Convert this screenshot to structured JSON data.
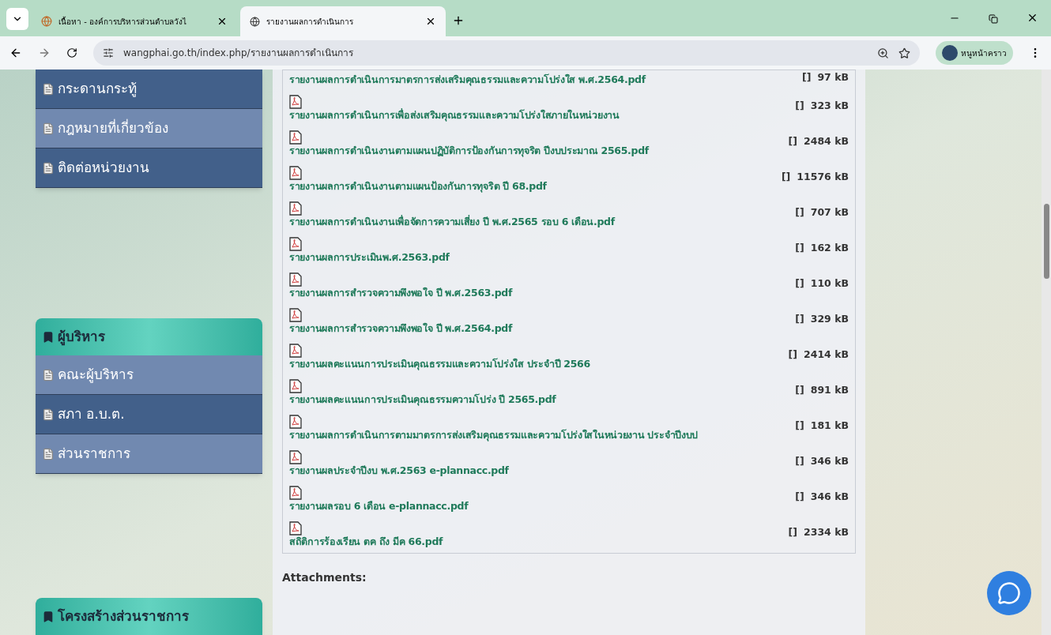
{
  "browser": {
    "tabs": [
      {
        "title": "เนื้อหา - องค์การบริหารส่วนตำบลวังไ",
        "selected": false
      },
      {
        "title": "รายงานผลการดำเนินการ",
        "selected": true
      }
    ],
    "url": "wangphai.go.th/index.php/รายงานผลการดำเนินการ",
    "profile": "หนูหน้าคราว"
  },
  "sidebar": {
    "groups": [
      {
        "items": [
          "กระดานกระทู้",
          "กฎหมายที่เกี่ยวข้อง",
          "ติดต่อหน่วยงาน"
        ]
      },
      {
        "title": "ผู้บริหาร",
        "items": [
          "คณะผู้บริหาร",
          "สภา อ.บ.ต.",
          "ส่วนราชการ"
        ]
      },
      {
        "title": "โครงสร้างส่วนราชการ"
      }
    ]
  },
  "files": [
    {
      "kind": "continued",
      "name": "รายงานผลการดำเนินการมาตรการส่งเสริมคุณธรรมและความโปร่งใส พ.ศ.2564.pdf",
      "marker": "[]",
      "size": "97 kB"
    },
    {
      "name": "รายงานผลการดำเนินการเพื่อส่งเสริมคุณธรรมและความโปร่งใสภายในหน่วยงาน",
      "marker": "[]",
      "size": "323 kB"
    },
    {
      "name": "รายงานผลการดำเนินงานตามแผนปฏิบัติการป้องกันการทุจริต ปีงบประมาณ 2565.pdf",
      "marker": "[]",
      "size": "2484 kB"
    },
    {
      "name": "รายงานผลการดำเนินงานตามแผนป้องกันการทุจริต ปี 68.pdf",
      "marker": "[]",
      "size": "11576 kB"
    },
    {
      "name": "รายงานผลการดำเนินงานเพื่อจัดการความเสี่ยง ปี พ.ศ.2565 รอบ 6 เดือน.pdf",
      "marker": "[]",
      "size": "707 kB"
    },
    {
      "name": "รายงานผลการประเมินพ.ศ.2563.pdf",
      "marker": "[]",
      "size": "162 kB"
    },
    {
      "name": "รายงานผลการสำรวจความพึงพอใจ ปี พ.ศ.2563.pdf",
      "marker": "[]",
      "size": "110 kB"
    },
    {
      "name": "รายงานผลการสำรวจความพึงพอใจ ปี พ.ศ.2564.pdf",
      "marker": "[]",
      "size": "329 kB"
    },
    {
      "name": "รายงานผลคะแนนการประเมินคุณธรรมและความโปร่งใส ประจำปี 2566",
      "marker": "[]",
      "size": "2414 kB"
    },
    {
      "name": "รายงานผลคะแนนการประเมินคุณธรรมความโปร่ง ปี 2565.pdf",
      "marker": "[]",
      "size": "891 kB"
    },
    {
      "name": "รายงานผลการดำเนินการตามมาตรการส่งเสริมคุณธรรมและความโปร่งใสในหน่วยงาน ประจำปีงบป",
      "marker": "[]",
      "size": "181 kB"
    },
    {
      "name": "รายงานผลประจำปีงบ พ.ศ.2563 e-plannacc.pdf",
      "marker": "[]",
      "size": "346 kB"
    },
    {
      "name": "รายงานผลรอบ 6 เดือน e-plannacc.pdf",
      "marker": "[]",
      "size": "346 kB"
    },
    {
      "name": "สถิติการร้องเรียน ตค ถึง มีค 66.pdf",
      "marker": "[]",
      "size": "2334 kB"
    }
  ],
  "attachments_label": "Attachments:"
}
